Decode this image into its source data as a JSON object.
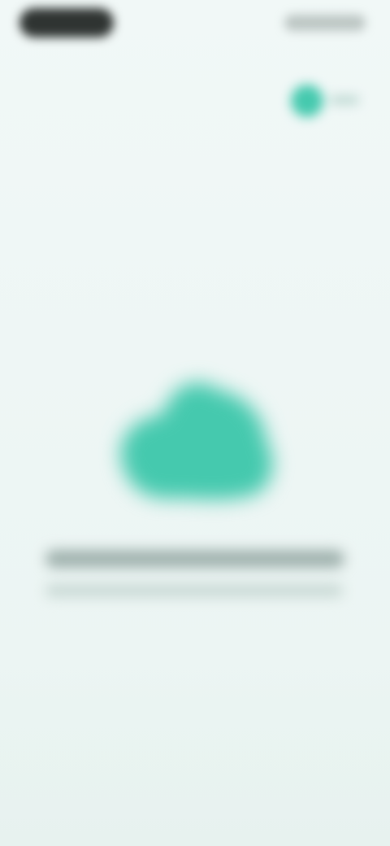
{
  "status_bar": {
    "time": "",
    "icons": [
      "signal-icon",
      "wifi-icon",
      "battery-icon"
    ]
  },
  "header": {
    "badge_icon": "status-dot-icon",
    "badge_label": ""
  },
  "hero": {
    "icon": "cloud-shape-icon",
    "accent_color": "#45c9ae"
  },
  "content": {
    "headline": "",
    "subtitle": ""
  },
  "colors": {
    "background": "#eef6f5",
    "accent": "#45c9ae",
    "text_primary": "#2f3432"
  }
}
